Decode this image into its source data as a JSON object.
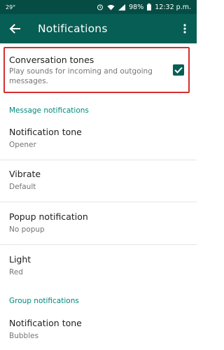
{
  "status_bar": {
    "temperature": "29°",
    "battery": "98%",
    "time": "12:32 p.m."
  },
  "app_bar": {
    "title": "Notifications",
    "back_icon": "arrow-back-icon",
    "more_icon": "more-vert-icon"
  },
  "conversation_tones": {
    "title": "Conversation tones",
    "subtitle": "Play sounds for incoming and outgoing messages.",
    "checked": true
  },
  "message_notifications": {
    "header": "Message notifications",
    "items": [
      {
        "title": "Notification tone",
        "value": "Opener"
      },
      {
        "title": "Vibrate",
        "value": "Default"
      },
      {
        "title": "Popup notification",
        "value": "No popup"
      },
      {
        "title": "Light",
        "value": "Red"
      }
    ]
  },
  "group_notifications": {
    "header": "Group notifications",
    "items": [
      {
        "title": "Notification tone",
        "value": "Bubbles"
      }
    ]
  },
  "colors": {
    "status_bar": "#054d44",
    "app_bar": "#075e54",
    "accent": "#00897b",
    "highlight": "#d32f2f"
  }
}
